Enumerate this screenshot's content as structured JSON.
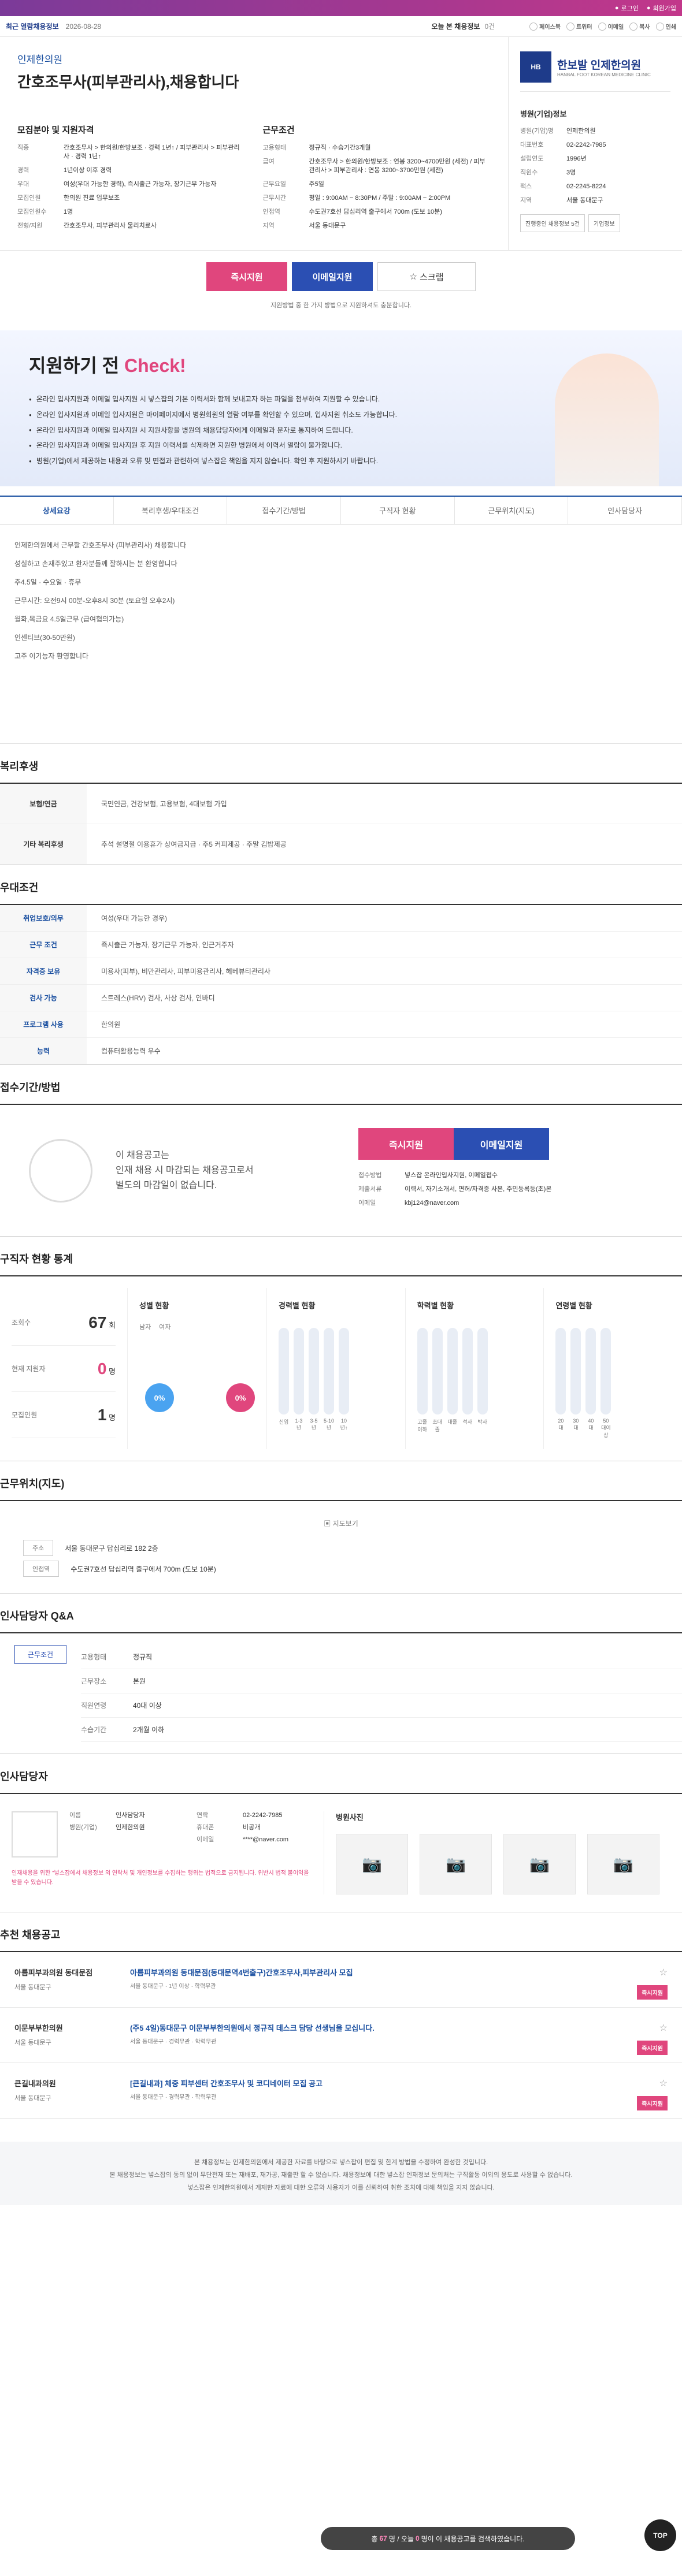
{
  "topbar": {
    "items": [
      "로그인",
      "회원가입"
    ]
  },
  "header": {
    "recent_label": "최근 열람채용정보",
    "date": "2026-08-28",
    "today_label": "오늘 본 채용정보",
    "today_count": "0건",
    "share": [
      "페이스북",
      "트위터",
      "이메일",
      "복사",
      "인쇄"
    ]
  },
  "job": {
    "company": "인제한의원",
    "title": "간호조무사(피부관리사),채용합니다",
    "field_heading": "모집분야 및 지원자격",
    "field": [
      {
        "k": "직종",
        "v": "간호조무사 > 한의원/한방보조 · 경력 1년↑ / 피부관리사 > 피부관리사 · 경력 1년↑"
      },
      {
        "k": "경력",
        "v": "1년이상 이후 경력"
      },
      {
        "k": "우대",
        "v": "여성(우대 가능한 경력), 즉시출근 가능자, 장기근무 가능자"
      },
      {
        "k": "모집인원",
        "v": "한의원 진료 업무보조"
      },
      {
        "k": "모집인원수",
        "v": "1명"
      },
      {
        "k": "전형/지원",
        "v": "간호조무사, 피부관리사 물리치료사"
      }
    ],
    "cond_heading": "근무조건",
    "cond": [
      {
        "k": "고용형태",
        "v": "정규직 · 수습기간3개월"
      },
      {
        "k": "급여",
        "v": "간호조무사 > 한의원/한방보조 : 연봉 3200~4700만원 (세전) / 피부관리사 > 피부관리사 : 연봉 3200~3700만원 (세전)"
      },
      {
        "k": "근무요일",
        "v": "주5일"
      },
      {
        "k": "근무시간",
        "v": "평일 : 9:00AM ~ 8:30PM / 주말 : 9:00AM ~ 2:00PM"
      },
      {
        "k": "인접역",
        "v": "수도권7호선 답십리역 출구에서 700m (도보 10분)"
      },
      {
        "k": "지역",
        "v": "서울 동대문구"
      }
    ]
  },
  "side": {
    "logo_name": "한보발 인제한의원",
    "logo_sub": "HANBAL FOOT KOREAN MEDICINE CLINIC",
    "logo_mark": "HB",
    "heading": "병원(기업)정보",
    "rows": [
      {
        "k": "병원(기업)명",
        "v": "인제한의원"
      },
      {
        "k": "대표번호",
        "v": "02-2242-7985"
      },
      {
        "k": "설립연도",
        "v": "1996년"
      },
      {
        "k": "직원수",
        "v": "3명"
      },
      {
        "k": "팩스",
        "v": "02-2245-8224"
      },
      {
        "k": "지역",
        "v": "서울 동대문구"
      }
    ],
    "btn1": "진행중인 채용정보 5건",
    "btn2": "기업정보"
  },
  "apply": {
    "now": "즉시지원",
    "email": "이메일지원",
    "scrap": "스크랩",
    "note": "지원방법 중 한 가지 방법으로 지원하셔도 충분합니다."
  },
  "check": {
    "title_a": "지원하기 전 ",
    "title_b": "Check!",
    "items": [
      "온라인 입사지원과 이메일 입사지원 시 넣스잡의 기본 이력서와 함께 보내고자 하는 파일을 첨부하여 지원할 수 있습니다.",
      "온라인 입사지원과 이메일 입사지원은 마이페이지에서 병원회원의 열람 여부를 확인할 수 있으며, 입사지원 취소도 가능합니다.",
      "온라인 입사지원과 이메일 입사지원 시 지원사항을 병원의 채용담당자에게 이메일과 문자로 통지하여 드립니다.",
      "온라인 입사지원과 이메일 입사지원 후 지원 이력서를 삭제하면 지원한 병원에서 이력서 열람이 불가합니다.",
      "병원(기업)에서 제공하는 내용과 오류 및 면접과 관련하여 넣스잡은 책임을 지지 않습니다. 확인 후 지원하시기 바랍니다."
    ]
  },
  "tabs": [
    "상세요강",
    "복리후생/우대조건",
    "접수기간/방법",
    "구직자 현황",
    "근무위치(지도)",
    "인사담당자"
  ],
  "detail": [
    "인제한의원에서 근무할 간호조무사 (피부관리사) 채용합니다",
    "성실하고 손재주있고 환자분들께 잘하시는 분 환영합니다",
    "주4.5일 · 수요일 · 휴무",
    "근무시간: 오전9시 00분-오후8시 30분 (토요일 오후2시)",
    "월화,목금요 4.5일근무 (급여협의가능)",
    "인센티브(30-50만원)",
    "고주 이기능자 환영합니다"
  ],
  "welfare": {
    "heading": "복리후생",
    "rows": [
      {
        "k": "보험/연금",
        "v": "국민연금, 건강보험, 고용보험, 4대보험 가입"
      },
      {
        "k": "기타 복리후생",
        "v": "추석 설명절 이용휴가 상여금지급 · 주5 커피제공 · 주말 김밥제공"
      }
    ]
  },
  "pref": {
    "heading": "우대조건",
    "rows": [
      {
        "k": "취업보호/의무",
        "v": "여성(우대 가능한 경우)"
      },
      {
        "k": "근무 조건",
        "v": "즉시출근 가능자, 장기근무 가능자, 인근거주자"
      },
      {
        "k": "자격증 보유",
        "v": "미용사(피부), 비만관리사, 피부미용관리사, 헤베뷰티관리사"
      },
      {
        "k": "검사 가능",
        "v": "스트레스(HRV) 검사, 사상 검사, 인바디"
      },
      {
        "k": "프로그램 사용",
        "v": "한의원"
      },
      {
        "k": "능력",
        "v": "컴퓨터활용능력 우수"
      }
    ]
  },
  "applyway": {
    "heading": "접수기간/방법",
    "msg1": "이 채용공고는",
    "msg2": "인재 채용 시 마감되는 채용공고로서",
    "msg3": "별도의 마감일이 없습니다.",
    "rows": [
      {
        "k": "접수방법",
        "v": "넣스잡 온라인입사지원, 이메일접수"
      },
      {
        "k": "제출서류",
        "v": "이력서, 자기소개서, 면허/자격증 사본, 주민등록등(초)본"
      },
      {
        "k": "이메일",
        "v": "kbj124@naver.com"
      }
    ]
  },
  "stats": {
    "heading": "구직자 현황 통계",
    "rows": [
      {
        "k": "조회수",
        "v": "67",
        "u": "회"
      },
      {
        "k": "현재 지원자",
        "v": "0",
        "u": "명"
      },
      {
        "k": "모집인원",
        "v": "1",
        "u": "명"
      }
    ],
    "gender_h": "성별 현황",
    "gender": [
      "남자",
      "여자"
    ],
    "gender_vals": [
      "0%",
      "0%"
    ],
    "career_h": "경력별 현황",
    "career": [
      "신입",
      "1-3년",
      "3-5년",
      "5-10년",
      "10년↑"
    ],
    "edu_h": "학력별 현황",
    "edu": [
      "고졸 이하",
      "초대졸",
      "대졸",
      "석사",
      "박사"
    ],
    "age_h": "연령별 현황",
    "age": [
      "20대",
      "30대",
      "40대",
      "50대이상"
    ]
  },
  "map": {
    "heading": "근무위치(지도)",
    "btn": "지도보기",
    "rows": [
      {
        "k": "주소",
        "v": "서울 동대문구 답십리로 182 2층"
      },
      {
        "k": "인접역",
        "v": "수도권7호선 답십리역 출구에서 700m (도보 10분)"
      }
    ]
  },
  "qa": {
    "heading": "인사담당자 Q&A",
    "tag": "근무조건",
    "rows": [
      {
        "k": "고용형태",
        "v": "정규직"
      },
      {
        "k": "근무장소",
        "v": "본원"
      },
      {
        "k": "직원연령",
        "v": "40대 이상"
      },
      {
        "k": "수습기간",
        "v": "2개월 이하"
      }
    ]
  },
  "contact": {
    "heading": "인사담당자",
    "rows": [
      {
        "k": "이름",
        "v": "인사담당자"
      },
      {
        "k": "병원(기업)",
        "v": "인제한의원"
      }
    ],
    "rows2": [
      {
        "k": "연락",
        "v": "02-2242-7985"
      },
      {
        "k": "휴대폰",
        "v": "비공개"
      },
      {
        "k": "이메일",
        "v": "****@naver.com"
      }
    ],
    "warn": "인재채용을 위한 \"넣스잡에서 채용정보 외 연락처 및 개인정보를 수집하는 행위는 법적으로 금지됩니다. 위반시 법적 불이익을 받을 수 있습니다.",
    "photo_h": "병원사진"
  },
  "recs": {
    "heading": "추천 채용공고",
    "items": [
      {
        "c": "아름피부과의원 동대문점",
        "loc": "서울 동대문구",
        "t": "아름피부과의원 동대문점(동대문역4번출구)간호조무사,피부관리사 모집",
        "meta": "서울 동대문구 · 1년 이상 · 학력무관"
      },
      {
        "c": "이문부부한의원",
        "loc": "서울 동대문구",
        "t": "(주5 4일)동대문구 이문부부한의원에서 정규직 데스크 담당 선생님을 모십니다.",
        "meta": "서울 동대문구 · 경력무관 · 학력무관"
      },
      {
        "c": "큰길내과의원",
        "loc": "서울 동대문구",
        "t": "[큰길내과] 체중 피부센터 간호조무사 및 코디네이터 모집 공고",
        "meta": "서울 동대문구 · 경력무관 · 학력무관"
      }
    ],
    "apply": "즉시지원"
  },
  "footer": {
    "lines": [
      "본 채용정보는 인제한의원에서 제공한 자료를 바탕으로 넣스잡이 편집 및 한계 방법을 수정하여 완성한 것입니다.",
      "본 채용정보는 넣스잡의 동의 없이 무단전재 또는 재배포, 재가공, 재출판 할 수 없습니다. 채용정보에 대한 넣스잡 인재정보 문의처는 구직활동 이외의 용도로 사용할 수 없습니다.",
      "넣스잡은 인제한의원에서 게재한 자료에 대한 오류와 사용자가 이를 신뢰하여 취한 조치에 대해 책임을 지지 않습니다."
    ]
  },
  "counter": {
    "a": "총 ",
    "b": "67",
    "c": "명 / 오늘 ",
    "d": "0",
    "e": "명이 이 채용공고를 검색하였습니다."
  },
  "top": "TOP"
}
